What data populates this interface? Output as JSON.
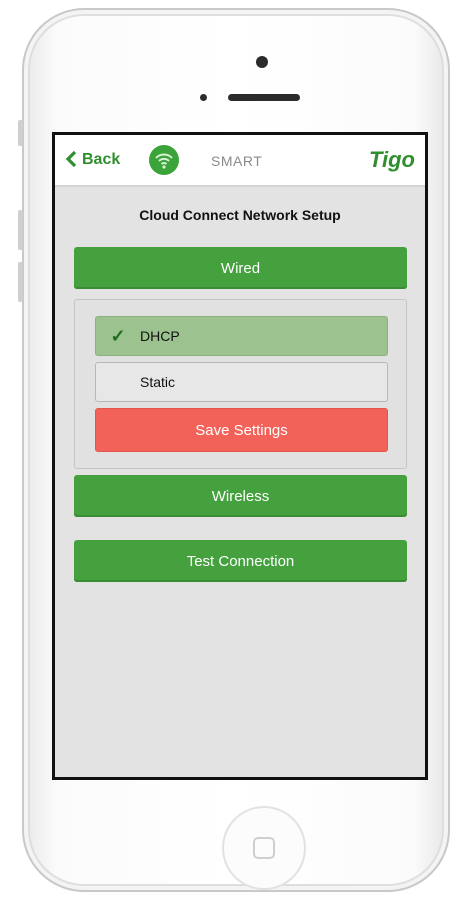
{
  "header": {
    "back_label": "Back",
    "app_label": "SMART",
    "logo_text": "Tigo"
  },
  "page": {
    "title": "Cloud Connect Network Setup"
  },
  "buttons": {
    "wired": "Wired",
    "wireless": "Wireless",
    "test_connection": "Test Connection",
    "save_settings": "Save Settings"
  },
  "options": {
    "dhcp": {
      "label": "DHCP",
      "selected": true
    },
    "static": {
      "label": "Static",
      "selected": false
    }
  },
  "icons": {
    "back": "chevron-left-icon",
    "wifi": "wifi-icon",
    "check": "checkmark-icon",
    "home": "home-button-icon"
  },
  "colors": {
    "primary_green": "#45a13e",
    "selected_option": "#9cc28f",
    "save_red": "#f26259",
    "background": "#e3e3e3"
  }
}
